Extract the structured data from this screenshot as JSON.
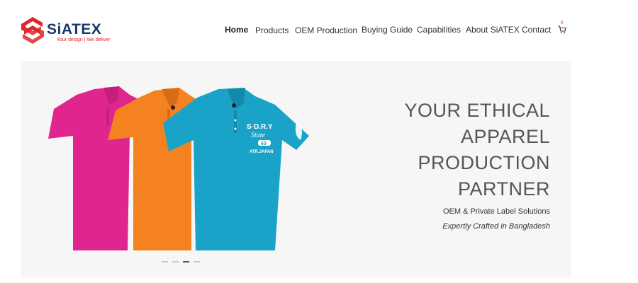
{
  "brand": {
    "name": "SiATEX",
    "tagline": "Your design | We deliver",
    "colors": {
      "red": "#e0262b",
      "navy": "#1a3a6b"
    }
  },
  "nav": {
    "items": [
      {
        "label": "Home",
        "active": true
      },
      {
        "label": "Products"
      },
      {
        "label": "OEM Production"
      },
      {
        "label": "Buying Guide"
      },
      {
        "label": "Capabilities"
      },
      {
        "label": "About SiATEX"
      },
      {
        "label": "Contact"
      }
    ],
    "cart_icon": "cart-icon",
    "cart_count": "0"
  },
  "hero": {
    "headline": [
      "YOUR ETHICAL",
      "APPAREL",
      "PRODUCTION",
      "PARTNER"
    ],
    "subtitle": "OEM & Private Label Solutions",
    "tagline": "Expertly Crafted in Bangladesh",
    "image": {
      "colors": [
        "#e0258e",
        "#f58220",
        "#1aa3c8"
      ],
      "print_text": [
        "S·D.R.Y",
        "State",
        "63",
        "ATR.JAPAN"
      ]
    },
    "slider": {
      "count": 4,
      "active_index": 2
    }
  }
}
